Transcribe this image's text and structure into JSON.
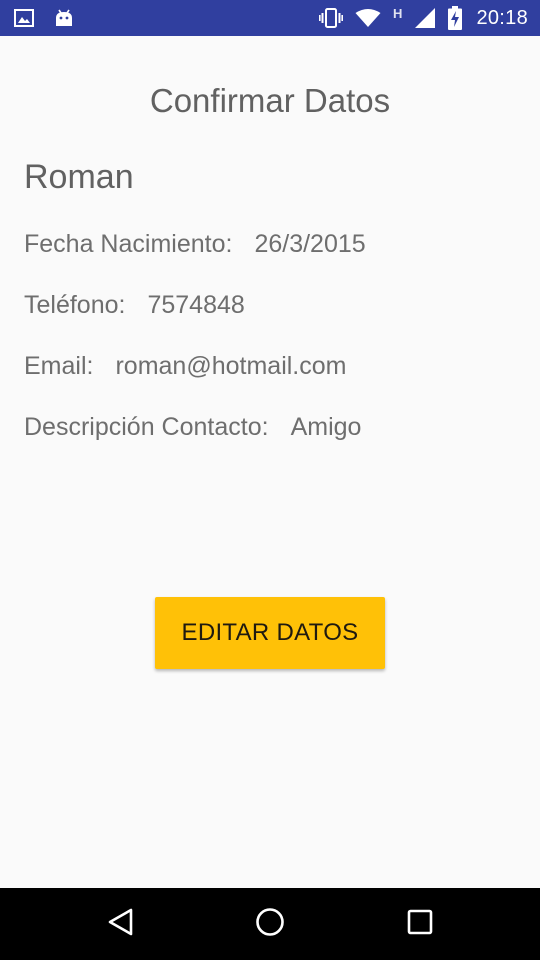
{
  "status_bar": {
    "time": "20:18",
    "network_type": "H",
    "icons": [
      "image-icon",
      "android-icon",
      "vibrate-icon",
      "wifi-icon",
      "cell-signal-icon",
      "battery-charging-icon"
    ],
    "background_color": "#303f9f"
  },
  "screen": {
    "title": "Confirmar Datos",
    "contact_name": "Roman",
    "fields": [
      {
        "label": "Fecha Nacimiento:",
        "value": "26/3/2015"
      },
      {
        "label": "Teléfono:",
        "value": "7574848"
      },
      {
        "label": "Email:",
        "value": "roman@hotmail.com"
      },
      {
        "label": "Descripción Contacto:",
        "value": "Amigo"
      }
    ],
    "edit_button_label": "EDITAR DATOS",
    "accent_color": "#ffc107"
  },
  "nav_bar": {
    "buttons": [
      "back-icon",
      "home-icon",
      "recents-icon"
    ]
  }
}
